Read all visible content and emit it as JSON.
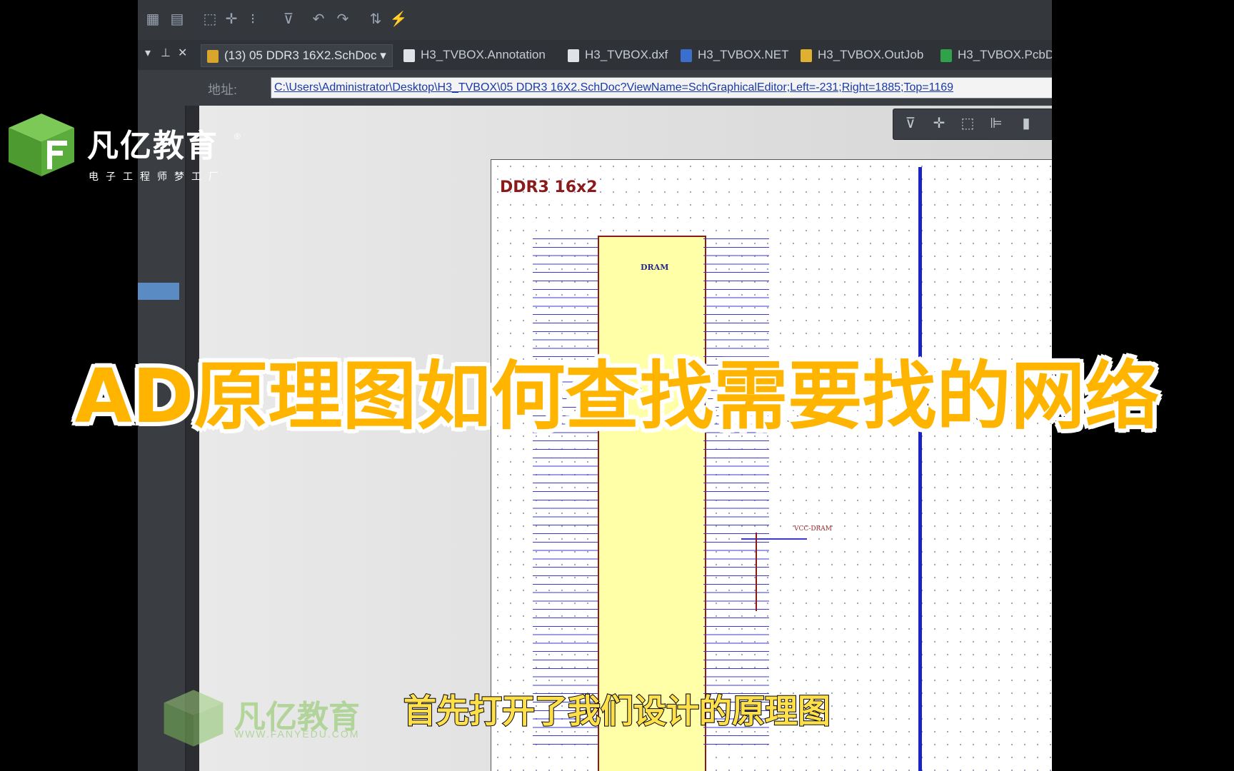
{
  "brand": {
    "name": "凡亿教育",
    "registered": "®",
    "tagline": "电子工程师梦工厂",
    "watermark_name": "凡亿教育",
    "watermark_url": "WWW.FANYEDU.COM",
    "color_green": "#5aad3c"
  },
  "headline": "AD原理图如何查找需要找的网络",
  "subtitle": "首先打开了我们设计的原理图",
  "app": {
    "tabs": [
      {
        "label": "(13) 05 DDR3 16X2.SchDoc",
        "active": true
      },
      {
        "label": "H3_TVBOX.Annotation"
      },
      {
        "label": "H3_TVBOX.dxf"
      },
      {
        "label": "H3_TVBOX.NET"
      },
      {
        "label": "H3_TVBOX.OutJob"
      },
      {
        "label": "H3_TVBOX.PcbD"
      }
    ],
    "address_label": "地址:",
    "address_value": "C:\\Users\\Administrator\\Desktop\\H3_TVBOX\\05 DDR3 16X2.SchDoc?ViewName=SchGraphicalEditor;Left=-231;Right=1885;Top=1169"
  },
  "schematic": {
    "sheet_title": "DDR3 16x2",
    "chip_label": "DRAM",
    "net_label": "VCC-DRAM",
    "bus_color": "#1a24c4",
    "chip_fill": "#ffffa8"
  }
}
